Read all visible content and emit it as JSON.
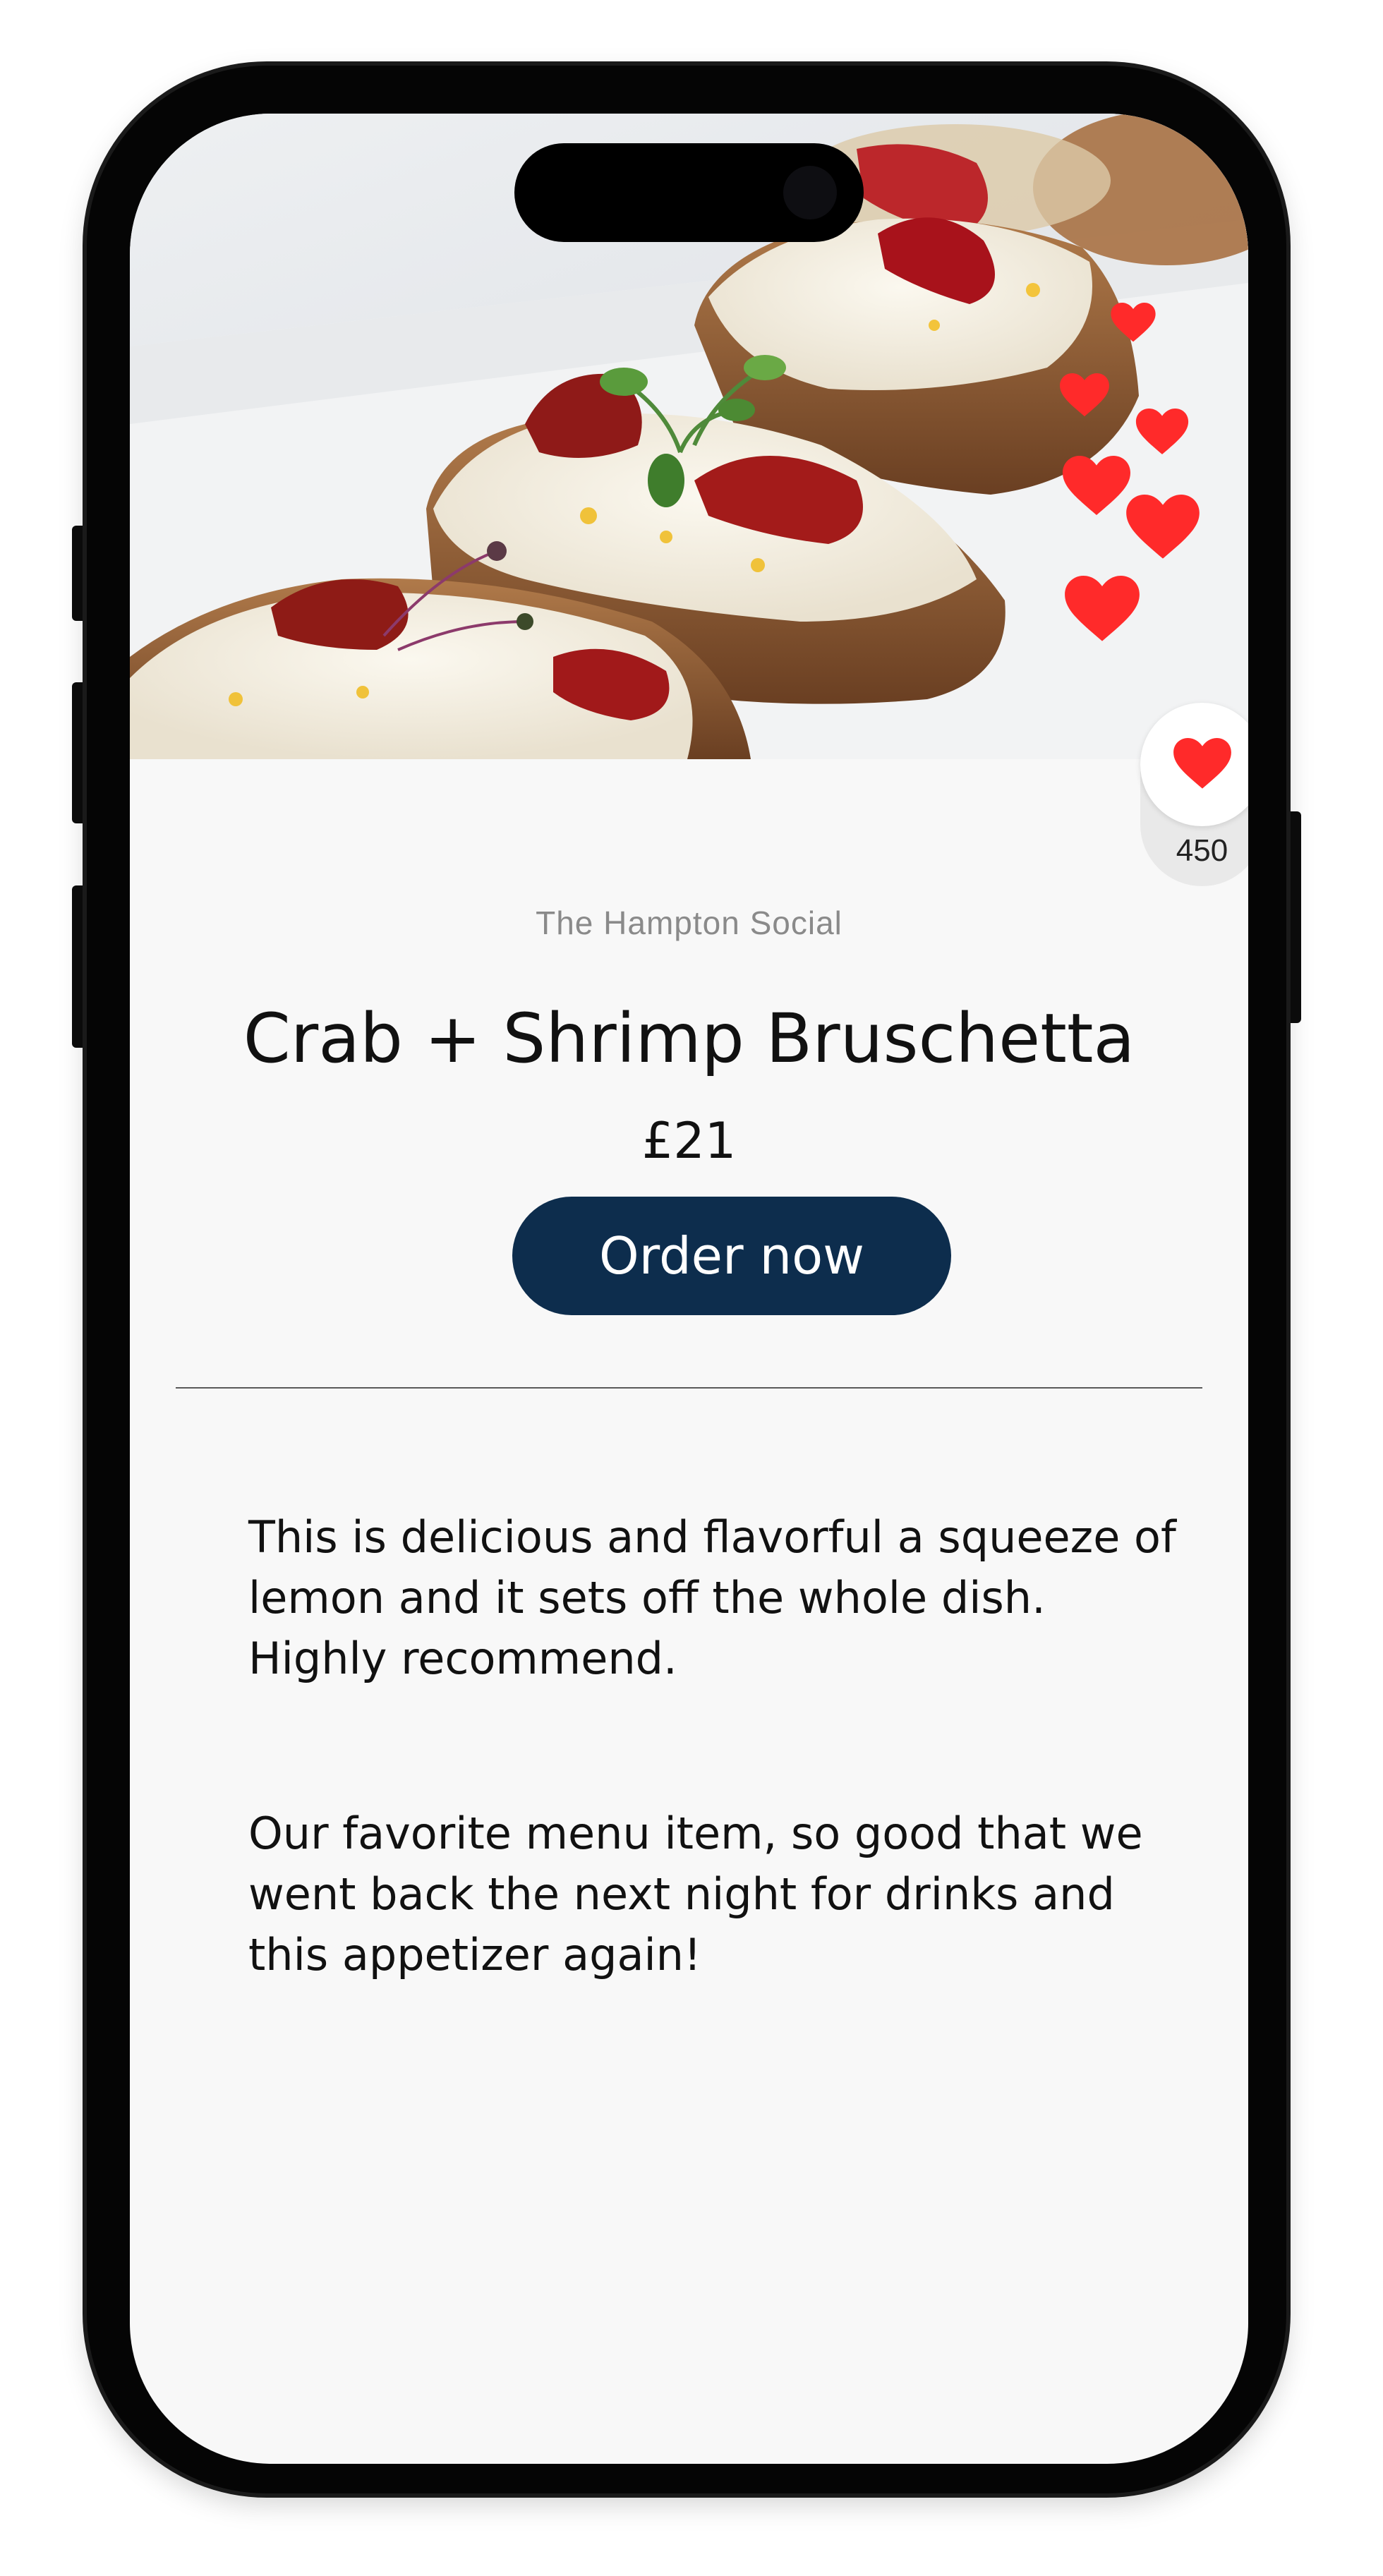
{
  "app": {
    "restaurant_name": "The Hampton Social",
    "dish_name": "Crab + Shrimp Bruschetta",
    "price": "£21",
    "order_button_label": "Order now"
  },
  "likes": {
    "count": "450",
    "icon": "heart-icon",
    "color": "#ff2a2a"
  },
  "reviews": [
    {
      "text": "This is delicious and flavorful a squeeze of lemon and it sets off the whole dish. Highly recommend."
    },
    {
      "text": "Our favorite menu item, so good that we went back the next night for drinks and this appetizer again!"
    }
  ],
  "colors": {
    "order_button_bg": "#0d2d4d",
    "screen_bg": "#f8f8f8",
    "heart": "#ff2a2a"
  }
}
